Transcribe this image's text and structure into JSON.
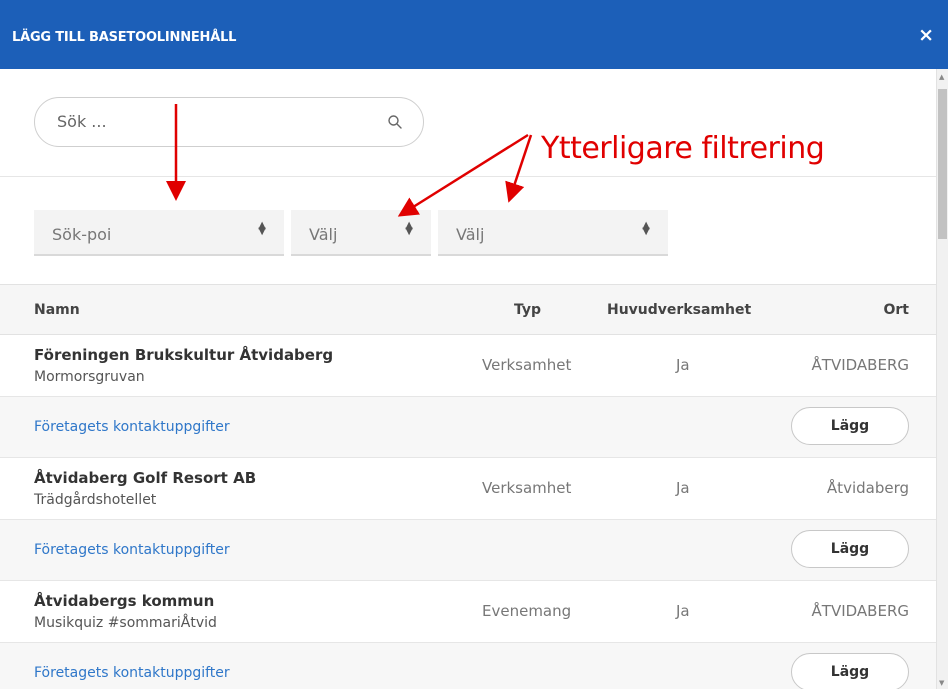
{
  "dialog": {
    "title": "LÄGG TILL BASETOOLINNEHÅLL",
    "close_label": "×"
  },
  "search": {
    "placeholder": "Sök ...",
    "icon": "search-icon"
  },
  "filters": [
    {
      "label": "Sök-poi"
    },
    {
      "label": "Välj"
    },
    {
      "label": "Välj"
    }
  ],
  "annotation": {
    "text": "Ytterligare filtrering",
    "color": "#e00000"
  },
  "table": {
    "headers": {
      "name": "Namn",
      "type": "Typ",
      "main": "Huvudverksamhet",
      "city": "Ort"
    },
    "rows": [
      {
        "name": "Föreningen Brukskultur Åtvidaberg",
        "sub": "Mormorsgruvan",
        "type": "Verksamhet",
        "main": "Ja",
        "city": "ÅTVIDABERG",
        "contact": "Företagets kontaktuppgifter",
        "button": "Lägg"
      },
      {
        "name": "Åtvidaberg Golf Resort AB",
        "sub": "Trädgårdshotellet",
        "type": "Verksamhet",
        "main": "Ja",
        "city": "Åtvidaberg",
        "contact": "Företagets kontaktuppgifter",
        "button": "Lägg"
      },
      {
        "name": "Åtvidabergs kommun",
        "sub": "Musikquiz #sommariÅtvid",
        "type": "Evenemang",
        "main": "Ja",
        "city": "ÅTVIDABERG",
        "contact": "Företagets kontaktuppgifter",
        "button": "Lägg"
      }
    ]
  },
  "colors": {
    "header_bg": "#1c5fb8",
    "link": "#2f77c9",
    "annotation": "#e00000"
  }
}
